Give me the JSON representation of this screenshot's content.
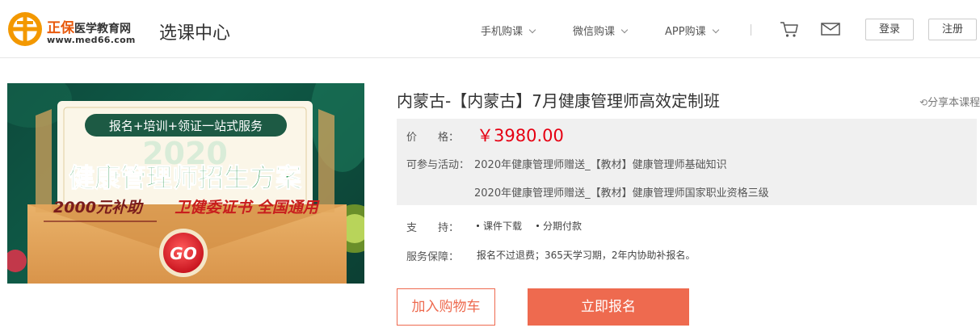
{
  "header": {
    "logo_brand": "正保",
    "logo_suffix": "医学教育网",
    "logo_url": "www.med66.com",
    "page_title": "选课中心",
    "nav": [
      {
        "label": "手机购课"
      },
      {
        "label": "微信购课"
      },
      {
        "label": "APP购课"
      }
    ],
    "cart_icon": "cart-icon",
    "mail_icon": "mail-icon",
    "login_label": "登录",
    "register_label": "注册"
  },
  "banner": {
    "tagline": "报名+培训+领证一站式服务",
    "year": "2020",
    "headline": "健康管理师招生方案",
    "subsidy": "2000元补助",
    "cert": "卫健委证书 全国通用",
    "go_label": "GO"
  },
  "course": {
    "title": "内蒙古-【内蒙古】7月健康管理师高效定制班",
    "share_label": "分享本课程",
    "price_label": "价　　格：",
    "price": "￥3980.00",
    "activity_label": "可参与活动：",
    "activities": [
      "2020年健康管理师赠送_【教材】健康管理师基础知识",
      "2020年健康管理师赠送_【教材】健康管理师国家职业资格三级"
    ],
    "support_label": "支　　持：",
    "support": [
      "课件下载",
      "分期付款"
    ],
    "service_label": "服务保障：",
    "service": "报名不过退费；365天学习期，2年内协助补报名。",
    "add_cart_label": "加入购物车",
    "enroll_label": "立即报名"
  },
  "colors": {
    "accent": "#ee6a4f",
    "price": "#e60012",
    "brand_orange": "#f39800"
  }
}
